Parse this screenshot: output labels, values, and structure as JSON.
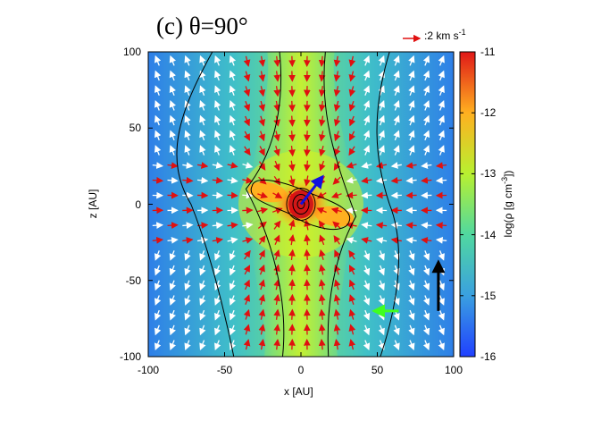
{
  "title": "(c) θ=90°",
  "velocity_scale_label": ":2 km s",
  "velocity_scale_exp": "-1",
  "chart_data": {
    "type": "heatmap",
    "title": "(c) θ=90°",
    "xlabel": "x [AU]",
    "ylabel": "z [AU]",
    "colorbar_label": "log(ρ [g cm",
    "colorbar_label_exp": "-3",
    "colorbar_label_end": "])",
    "xlim": [
      -100,
      100
    ],
    "ylim": [
      -100,
      100
    ],
    "clim": [
      -16,
      -11
    ],
    "x_ticks": [
      "-100",
      "-50",
      "0",
      "50",
      "100"
    ],
    "y_ticks": [
      "100",
      "50",
      "0",
      "-50",
      "-100"
    ],
    "colorbar_ticks": [
      "-11",
      "-12",
      "-13",
      "-14",
      "-15",
      "-16"
    ],
    "velocity_reference_km_s": 2,
    "density_peak": {
      "x": 0,
      "z": 0,
      "log_rho": -11.2
    },
    "disk_feature": {
      "x_extent": [
        -30,
        30
      ],
      "z_extent": [
        -15,
        15
      ],
      "log_rho": -12.5
    },
    "outflow_arrows": [
      {
        "name": "blue",
        "color": "#1010e0",
        "x0": 0,
        "z0": 0,
        "x1": 14,
        "z1": 18
      },
      {
        "name": "black",
        "color": "#000000",
        "x0": 90,
        "z0": -70,
        "x1": 90,
        "z1": -38
      },
      {
        "name": "green",
        "color": "#40ff20",
        "x0": 64,
        "z0": -70,
        "x1": 48,
        "z1": -70
      }
    ],
    "colors": {
      "velocity_in": "#e01010",
      "velocity_out": "#ffffff",
      "contour": "#000000"
    }
  }
}
